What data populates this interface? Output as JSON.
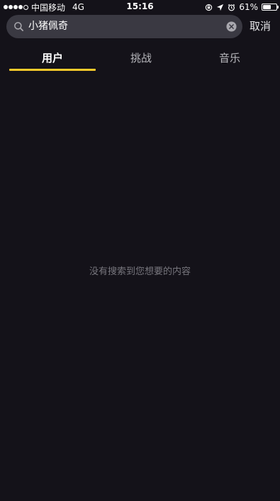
{
  "status_bar": {
    "carrier": "中国移动",
    "network": "4G",
    "time": "15:16",
    "battery": "61%",
    "battery_level": 0.61,
    "signal_bars_filled": 4,
    "signal_bars_total": 5
  },
  "search": {
    "query": "小猪佩奇",
    "cancel_label": "取消"
  },
  "tabs": [
    {
      "label": "用户",
      "active": true
    },
    {
      "label": "挑战",
      "active": false
    },
    {
      "label": "音乐",
      "active": false
    }
  ],
  "empty_state": {
    "message": "没有搜索到您想要的内容"
  },
  "colors": {
    "background": "#141219",
    "accent": "#f8ca2b",
    "search_box": "#3a3942"
  },
  "icons": [
    "search-icon",
    "clear-icon",
    "rotation-lock-icon",
    "location-arrow-icon",
    "alarm-icon",
    "battery-icon"
  ]
}
